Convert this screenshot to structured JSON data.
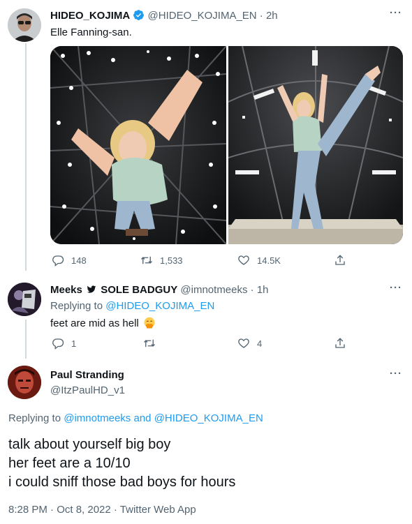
{
  "tweet1": {
    "name": "HIDEO_KOJIMA",
    "handle": "@HIDEO_KOJIMA_EN",
    "time": "· 2h",
    "text": "Elle Fanning-san.",
    "more": "···",
    "photos": [
      {
        "icon": "photo-elle-fanning-hands"
      },
      {
        "icon": "photo-elle-fanning-kick"
      }
    ],
    "actions": {
      "replies": "148",
      "retweets": "1,533",
      "likes": "14.5K"
    },
    "colors": {
      "verified": "#1d9bf0"
    }
  },
  "tweet2": {
    "name": "Meeks",
    "name_suffix": "SOLE BADGUY",
    "handle": "@imnotmeeks",
    "time": "· 1h",
    "replying_prefix": "Replying to",
    "replying_to": "@HIDEO_KOJIMA_EN",
    "text": "feet are mid as hell",
    "emoji": "face-with-hand-over-mouth-emoji",
    "more": "···",
    "actions": {
      "replies": "1",
      "retweets": "",
      "likes": "4"
    }
  },
  "tweet3": {
    "name": "Paul Stranding",
    "handle": "@ItzPaulHD_v1",
    "more": "···",
    "replying_prefix": "Replying to",
    "replying_to_1": "@imnotmeeks",
    "replying_and": "and",
    "replying_to_2": "@HIDEO_KOJIMA_EN",
    "lines": [
      "talk about yourself big boy",
      "her feet are a 10/10",
      "i could sniff those bad boys for hours"
    ],
    "timestamp": "8:28 PM · Oct 8, 2022 · Twitter Web App"
  },
  "colors": {
    "accent": "#1d9bf0",
    "muted": "#536471",
    "text": "#0f1419"
  }
}
